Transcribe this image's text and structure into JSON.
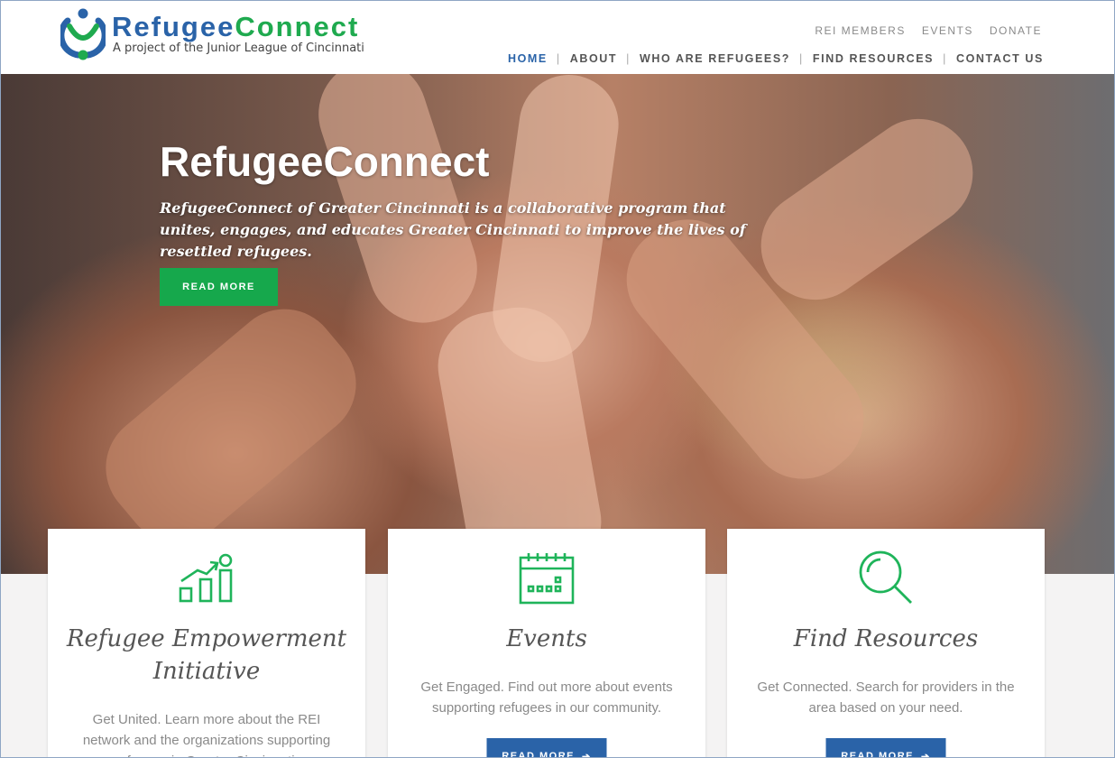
{
  "header": {
    "brand_part1": "Refugee",
    "brand_part2": "Connect",
    "tagline": "A project of the Junior League of Cincinnati",
    "top_nav": [
      "REI MEMBERS",
      "EVENTS",
      "DONATE"
    ],
    "main_nav": [
      "HOME",
      "ABOUT",
      "WHO ARE REFUGEES?",
      "FIND RESOURCES",
      "CONTACT US"
    ],
    "active_nav": "HOME"
  },
  "hero": {
    "title": "RefugeeConnect",
    "subtitle": "RefugeeConnect of Greater Cincinnati is a collaborative program that unites, engages, and educates Greater Cincinnati to improve the lives of resettled refugees.",
    "button_label": "READ MORE"
  },
  "cards": [
    {
      "icon": "growth-chart-icon",
      "title": "Refugee Empowerment Initiative",
      "text": "Get United. Learn more about the REI network and the organizations supporting refugees in Greater Cincinnati."
    },
    {
      "icon": "calendar-icon",
      "title": "Events",
      "text": "Get Engaged. Find out more about events supporting refugees in our community.",
      "button_label": "READ MORE"
    },
    {
      "icon": "magnifier-icon",
      "title": "Find Resources",
      "text": "Get Connected. Search for providers in the area based on your need.",
      "button_label": "READ MORE"
    }
  ],
  "colors": {
    "brand_blue": "#2a63a8",
    "brand_green": "#16a84c",
    "icon_green": "#1fb45a"
  }
}
